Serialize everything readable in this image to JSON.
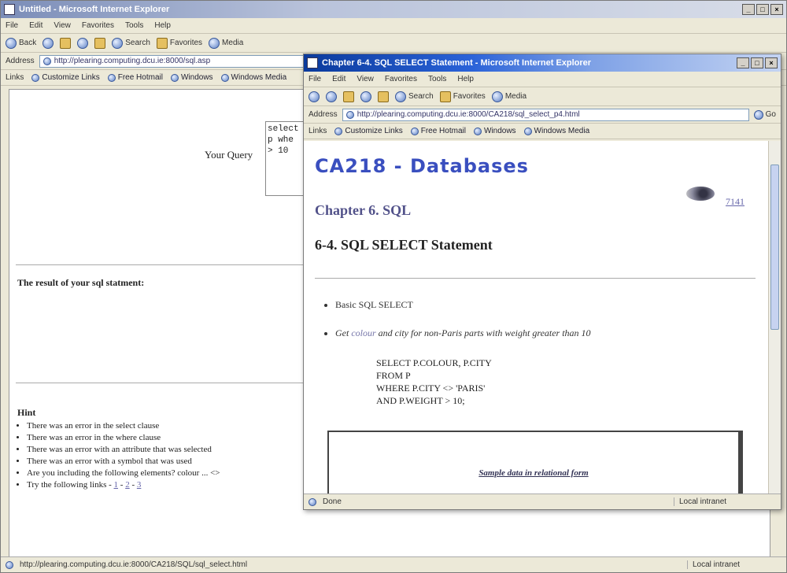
{
  "back_window": {
    "title": "Untitled - Microsoft Internet Explorer",
    "menu": [
      "File",
      "Edit",
      "View",
      "Favorites",
      "Tools",
      "Help"
    ],
    "toolbar": [
      "Back",
      "Forward",
      "Search",
      "Favorites",
      "Media"
    ],
    "address_label": "Address",
    "address_value": "http://plearing.computing.dcu.ie:8000/sql.asp",
    "links_label": "Links",
    "links": [
      "Customize Links",
      "Free Hotmail",
      "Windows",
      "Windows Media"
    ],
    "query_label": "Your Query",
    "query_lines": [
      "select",
      "p whe",
      "> 10"
    ],
    "result_heading": "The result of your sql statment:",
    "hint_heading": "Hint",
    "hints": [
      "There was an error in the select clause",
      "There was an error in the where clause",
      "There was an error with an attribute that was selected",
      "There was an error with a symbol that was used",
      "Are you including the following elements? colour ... <>",
      "Try the following links - "
    ],
    "hint_links": [
      "1",
      "2",
      "3"
    ],
    "hint_links_sep": " - ",
    "status_left": "http://plearing.computing.dcu.ie:8000/CA218/SQL/sql_select.html",
    "status_right": "Local intranet"
  },
  "front_window": {
    "title": "Chapter 6-4. SQL SELECT Statement - Microsoft Internet Explorer",
    "menu": [
      "File",
      "Edit",
      "View",
      "Favorites",
      "Tools",
      "Help"
    ],
    "toolbar": [
      "Back",
      "Forward",
      "Search",
      "Favorites",
      "Media"
    ],
    "address_label": "Address",
    "address_value": "http://plearing.computing.dcu.ie:8000/CA218/sql_select_p4.html",
    "go_label": "Go",
    "links_label": "Links",
    "links": [
      "Customize Links",
      "Free Hotmail",
      "Windows",
      "Windows Media"
    ],
    "course_title": "CA218 - Databases",
    "chapter_title": "Chapter 6. SQL",
    "page_number": "7141",
    "section_title": "6-4. SQL SELECT Statement",
    "bullet_1": "Basic SQL SELECT",
    "bullet_2_prefix": "Get ",
    "bullet_2_link": "colour",
    "bullet_2_suffix": " and city for non-Paris parts with weight greater than 10",
    "code_lines": [
      "SELECT P.COLOUR, P.CITY",
      "FROM P",
      "WHERE P.CITY <> 'PARIS'",
      "AND P.WEIGHT > 10;"
    ],
    "sample_caption": "Sample data in relational form",
    "status_left": "Done",
    "status_right": "Local intranet"
  }
}
